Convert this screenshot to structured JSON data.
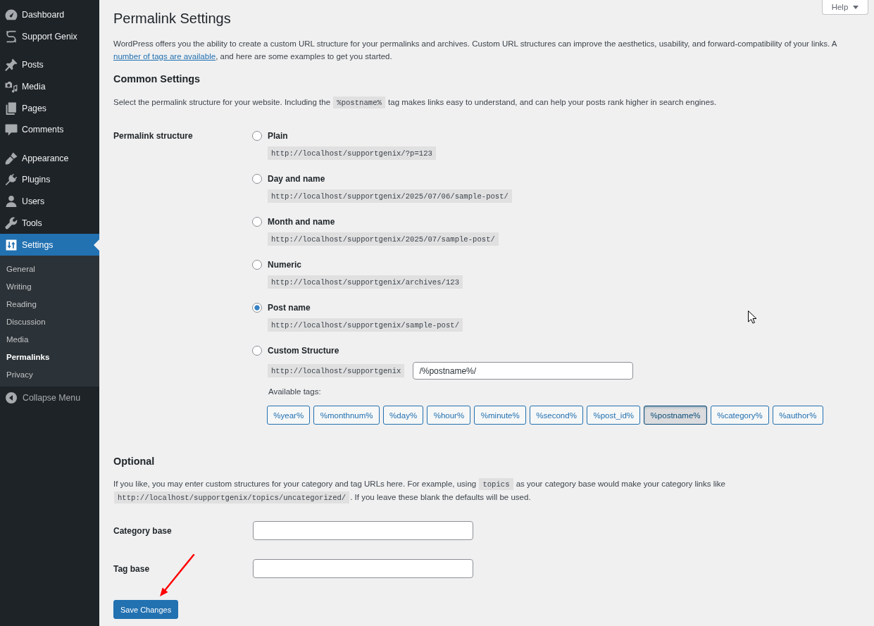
{
  "sidebar": {
    "menu_groups": [
      {
        "items": [
          {
            "label": "Dashboard",
            "selected": false
          },
          {
            "label": "Support Genix",
            "selected": false
          }
        ]
      },
      {
        "items": [
          {
            "label": "Posts",
            "selected": false
          },
          {
            "label": "Media",
            "selected": false
          },
          {
            "label": "Pages",
            "selected": false
          },
          {
            "label": "Comments",
            "selected": false
          }
        ]
      },
      {
        "items": [
          {
            "label": "Appearance",
            "selected": false
          },
          {
            "label": "Plugins",
            "selected": false
          },
          {
            "label": "Users",
            "selected": false
          },
          {
            "label": "Tools",
            "selected": false
          },
          {
            "label": "Settings",
            "selected": true,
            "children": [
              {
                "label": "General",
                "selected": false
              },
              {
                "label": "Writing",
                "selected": false
              },
              {
                "label": "Reading",
                "selected": false
              },
              {
                "label": "Discussion",
                "selected": false
              },
              {
                "label": "Media",
                "selected": false
              },
              {
                "label": "Permalinks",
                "selected": true
              },
              {
                "label": "Privacy",
                "selected": false
              }
            ]
          }
        ]
      }
    ],
    "collapse_label": "Collapse Menu"
  },
  "page_title": "Permalink Settings",
  "help_button": {
    "label": "Help"
  },
  "intro": [
    {
      "kind": "text",
      "text": "WordPress offers you the ability to create a custom URL structure for your permalinks and archives. Custom URL structures can improve the aesthetics, usability, and forward-compatibility of your links. A "
    },
    {
      "kind": "link",
      "text": "number of tags are available"
    },
    {
      "kind": "text",
      "text": ", and here are some examples to get you started."
    }
  ],
  "common_settings": {
    "heading": "Common Settings",
    "description": [
      {
        "kind": "text",
        "text": "Select the permalink structure for your website. Including the "
      },
      {
        "kind": "code",
        "text": "%postname%"
      },
      {
        "kind": "text",
        "text": " tag makes links easy to understand, and can help your posts rank higher in search engines."
      }
    ]
  },
  "permalink_structure": {
    "label": "Permalink structure",
    "options": [
      {
        "kind": "preset",
        "label": "Plain",
        "example": "http://localhost/supportgenix/?p=123",
        "selected": false
      },
      {
        "kind": "preset",
        "label": "Day and name",
        "example": "http://localhost/supportgenix/2025/07/06/sample-post/",
        "selected": false
      },
      {
        "kind": "preset",
        "label": "Month and name",
        "example": "http://localhost/supportgenix/2025/07/sample-post/",
        "selected": false
      },
      {
        "kind": "preset",
        "label": "Numeric",
        "example": "http://localhost/supportgenix/archives/123",
        "selected": false
      },
      {
        "kind": "preset",
        "label": "Post name",
        "example": "http://localhost/supportgenix/sample-post/",
        "selected": true
      },
      {
        "kind": "custom",
        "label": "Custom Structure",
        "selected": false,
        "prefix": "http://localhost/supportgenix",
        "value": "/%postname%/",
        "tags_label": "Available tags:",
        "tags": [
          {
            "label": "%year%",
            "selected": false
          },
          {
            "label": "%monthnum%",
            "selected": false
          },
          {
            "label": "%day%",
            "selected": false
          },
          {
            "label": "%hour%",
            "selected": false
          },
          {
            "label": "%minute%",
            "selected": false
          },
          {
            "label": "%second%",
            "selected": false
          },
          {
            "label": "%post_id%",
            "selected": false
          },
          {
            "label": "%postname%",
            "selected": true
          },
          {
            "label": "%category%",
            "selected": false
          },
          {
            "label": "%author%",
            "selected": false
          }
        ]
      }
    ]
  },
  "optional": {
    "heading": "Optional",
    "description": [
      {
        "kind": "text",
        "text": "If you like, you may enter custom structures for your category and tag URLs here. For example, using "
      },
      {
        "kind": "code",
        "text": "topics"
      },
      {
        "kind": "text",
        "text": " as your category base would make your category links like "
      },
      {
        "kind": "code",
        "text": "http://localhost/supportgenix/topics/uncategorized/"
      },
      {
        "kind": "text",
        "text": ". If you leave these blank the defaults will be used."
      }
    ],
    "fields": [
      {
        "label": "Category base"
      },
      {
        "label": "Tag base"
      }
    ]
  },
  "save_button": {
    "label": "Save Changes"
  }
}
